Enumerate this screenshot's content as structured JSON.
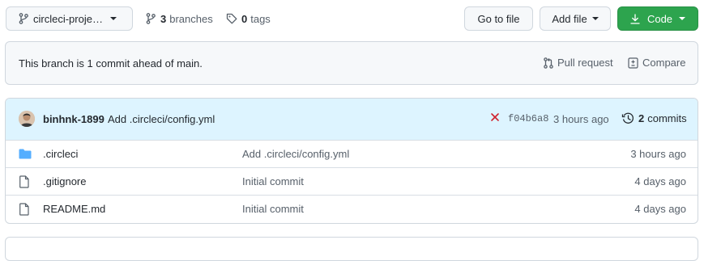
{
  "toolbar": {
    "branch_select": "circleci-proje…",
    "branches_count": "3",
    "branches_label": "branches",
    "tags_count": "0",
    "tags_label": "tags",
    "go_to_file": "Go to file",
    "add_file": "Add file",
    "code": "Code"
  },
  "branch_status": {
    "message": "This branch is 1 commit ahead of main.",
    "pull_request": "Pull request",
    "compare": "Compare"
  },
  "commit": {
    "author": "binhnk-1899",
    "message": "Add .circleci/config.yml",
    "sha": "f04b6a8",
    "time": "3 hours ago",
    "commits_count": "2",
    "commits_label": "commits"
  },
  "files": [
    {
      "name": ".circleci",
      "type": "folder",
      "message": "Add .circleci/config.yml",
      "time": "3 hours ago"
    },
    {
      "name": ".gitignore",
      "type": "file",
      "message": "Initial commit",
      "time": "4 days ago"
    },
    {
      "name": "README.md",
      "type": "file",
      "message": "Initial commit",
      "time": "4 days ago"
    }
  ],
  "colors": {
    "code_button": "#2da44e",
    "folder_icon": "#54aeff",
    "fail_x": "#cf222e",
    "header_bg": "#ddf4ff"
  }
}
